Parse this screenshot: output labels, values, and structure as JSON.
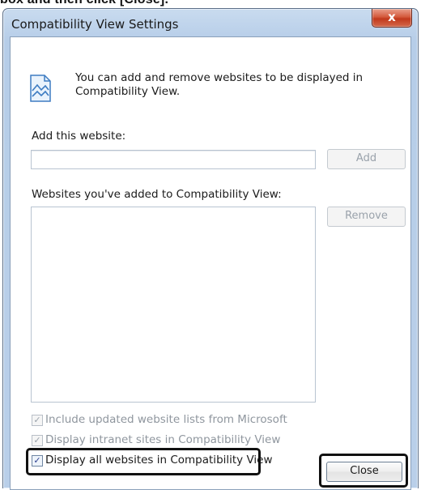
{
  "caption": "box and then click [Close].",
  "dialog": {
    "title": "Compatibility View Settings",
    "close_glyph": "x",
    "info_text": "You can add and remove websites to be displayed in Compatibility View.",
    "add_label": "Add this website:",
    "add_input_value": "",
    "add_button": "Add",
    "list_label": "Websites you've added to Compatibility View:",
    "websites": [],
    "remove_button": "Remove",
    "checkboxes": [
      {
        "label": "Include updated website lists from Microsoft",
        "checked": true,
        "enabled": false
      },
      {
        "label": "Display intranet sites in Compatibility View",
        "checked": true,
        "enabled": false
      },
      {
        "label": "Display all websites in Compatibility View",
        "checked": true,
        "enabled": true
      }
    ],
    "close_button": "Close"
  },
  "colors": {
    "frame": "#b9cfe9",
    "close_red": "#c1391c",
    "highlight": "#111111"
  },
  "icons": {
    "info": "compatibility-view-icon",
    "check": "checkmark-icon"
  }
}
